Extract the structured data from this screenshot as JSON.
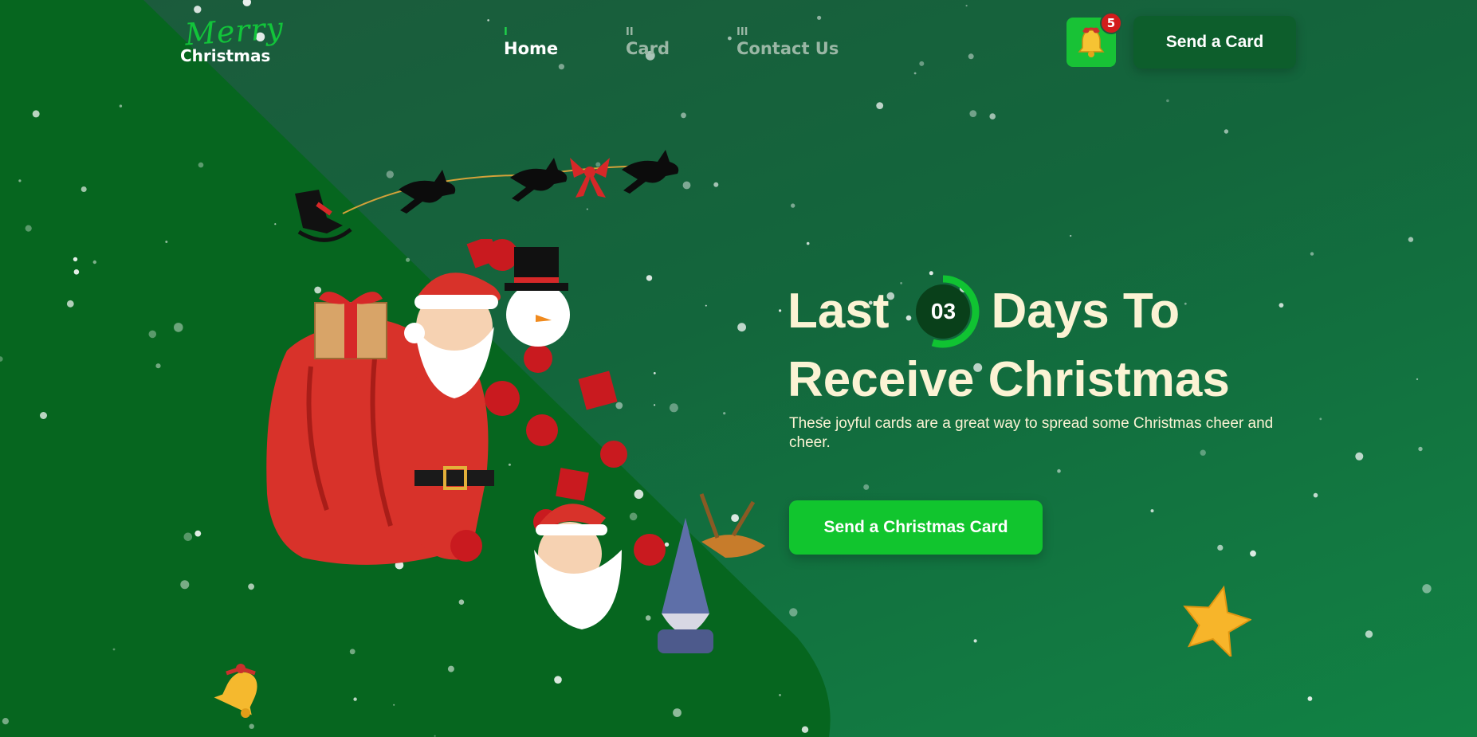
{
  "logo": {
    "script": "Merry",
    "sub": "Christmas"
  },
  "nav": [
    {
      "num": "I",
      "label": "Home",
      "active": true
    },
    {
      "num": "II",
      "label": "Card",
      "active": false
    },
    {
      "num": "III",
      "label": "Contact Us",
      "active": false
    }
  ],
  "notifications": {
    "count": "5",
    "icon": "bell-icon"
  },
  "header": {
    "send_card_label": "Send a Card"
  },
  "hero": {
    "title_pre": "Last",
    "days_count": "03",
    "title_post": "Days To",
    "title_line2": "Receive Christmas",
    "description": "These joyful cards are a great way to spread some Christmas cheer and cheer.",
    "cta_label": "Send a Christmas Card",
    "countdown_fraction": 0.55
  },
  "colors": {
    "accent_green": "#11c52e",
    "dark_green": "#0d5e2c",
    "cream_text": "#fbf3d4",
    "badge_red": "#d21c1c"
  }
}
